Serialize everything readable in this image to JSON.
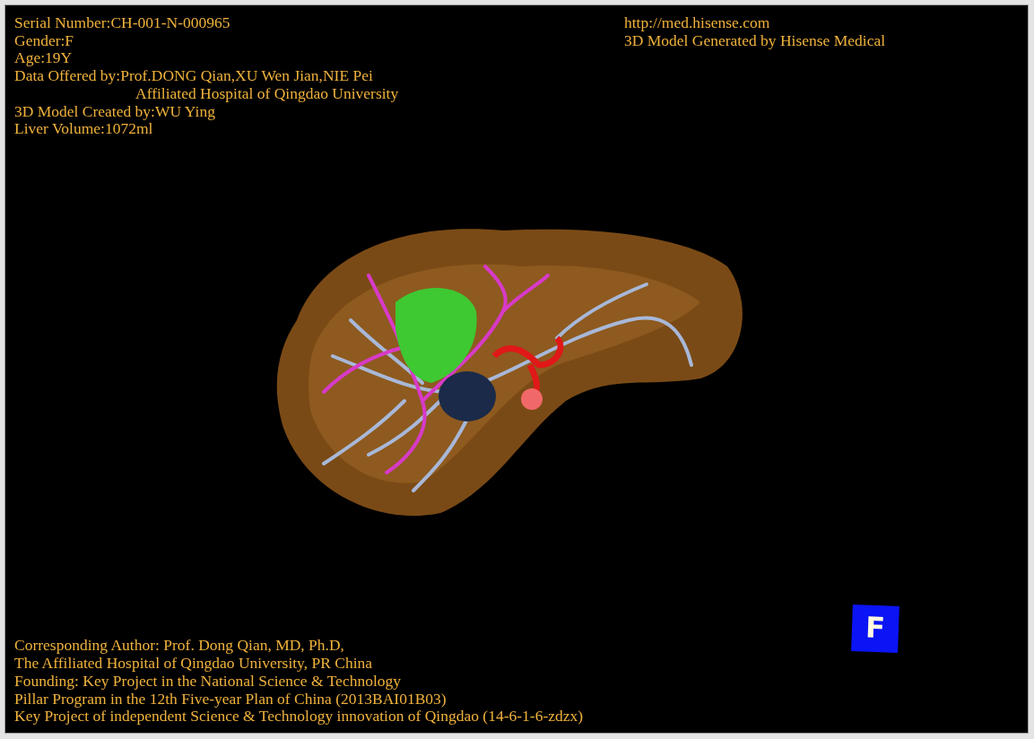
{
  "info_lines": [
    {
      "kind": "plain",
      "text": "Serial Number:CH-001-N-000965"
    },
    {
      "kind": "plain",
      "text": "Gender:F"
    },
    {
      "kind": "plain",
      "text": "Age:19Y"
    },
    {
      "kind": "plain",
      "text": "Data Offered by:Prof.DONG Qian,XU Wen Jian,NIE Pei"
    },
    {
      "kind": "indented",
      "text": "Affiliated Hospital of Qingdao University"
    },
    {
      "kind": "plain",
      "text": "3D Model Created by:WU Ying"
    },
    {
      "kind": "plain",
      "text": "Liver Volume:1072ml"
    }
  ],
  "site_lines": [
    "http://med.hisense.com",
    "3D Model Generated by Hisense Medical"
  ],
  "credit_lines": [
    "Corresponding Author: Prof. Dong Qian, MD, Ph.D,",
    "The Affiliated Hospital of Qingdao University, PR China",
    "Founding: Key Project in the National Science & Technology",
    "Pillar Program in the 12th Five-year Plan of China (2013BAI01B03)",
    "Key Project of independent Science & Technology innovation of Qingdao (14-6-1-6-zdzx)"
  ],
  "orientation_cube": {
    "label": "F"
  }
}
